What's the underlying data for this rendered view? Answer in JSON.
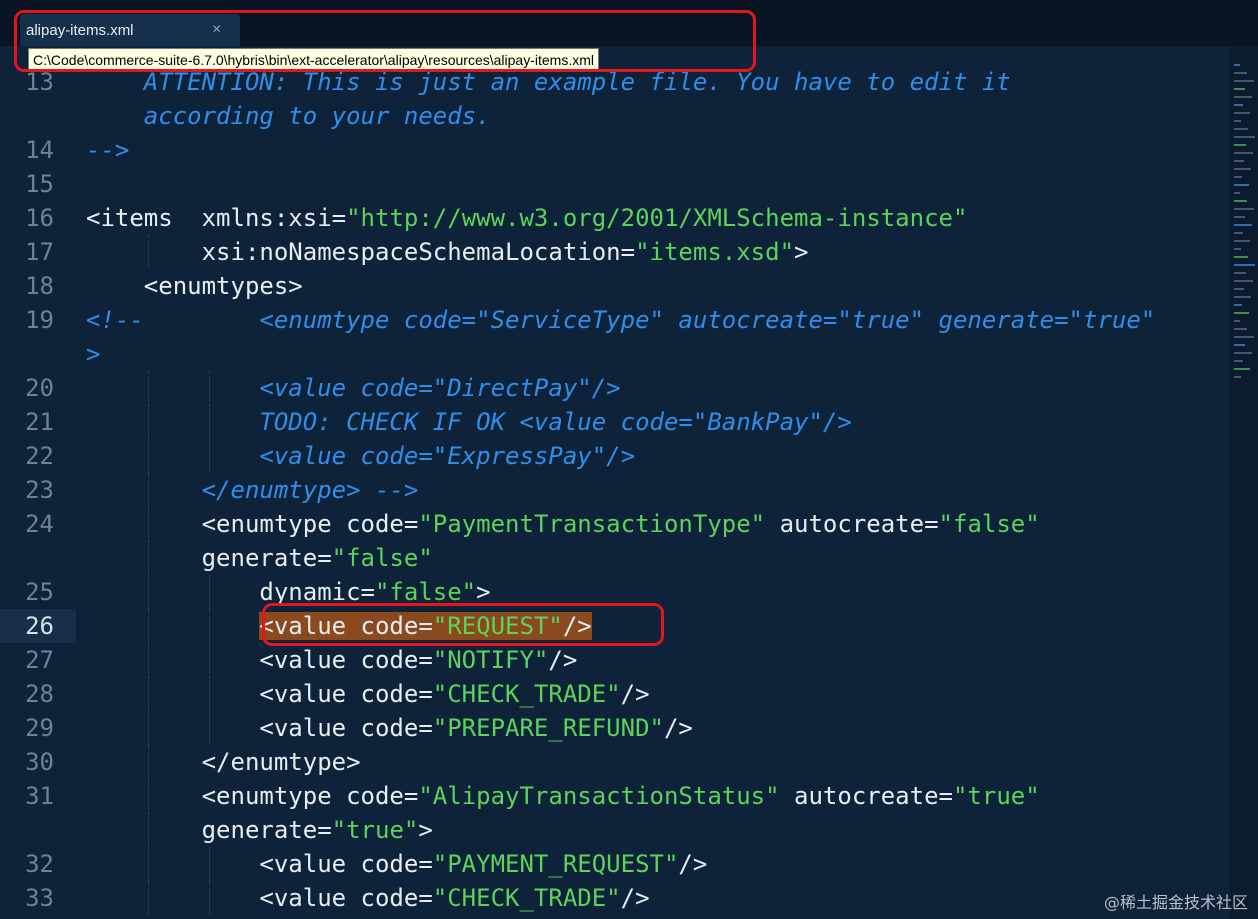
{
  "tab": {
    "title": "alipay-items.xml",
    "close_icon": "×"
  },
  "tooltip": {
    "path": "C:\\Code\\commerce-suite-6.7.0\\hybris\\bin\\ext-accelerator\\alipay\\resources\\alipay-items.xml"
  },
  "editor": {
    "current_line": "26",
    "lines": [
      {
        "n": "13",
        "text": "    ATTENTION: This is just an example file. You have to edit it"
      },
      {
        "n": "",
        "text": "    according to your needs."
      },
      {
        "n": "14",
        "text": "-->"
      },
      {
        "n": "15",
        "text": ""
      },
      {
        "n": "16",
        "text": "<items  xmlns:xsi=\"http://www.w3.org/2001/XMLSchema-instance\""
      },
      {
        "n": "17",
        "text": "        xsi:noNamespaceSchemaLocation=\"items.xsd\">"
      },
      {
        "n": "18",
        "text": "    <enumtypes>"
      },
      {
        "n": "19",
        "text": "<!--        <enumtype code=\"ServiceType\" autocreate=\"true\" generate=\"true\""
      },
      {
        "n": "",
        "text": ">"
      },
      {
        "n": "20",
        "text": "            <value code=\"DirectPay\"/>"
      },
      {
        "n": "21",
        "text": "            TODO: CHECK IF OK <value code=\"BankPay\"/>"
      },
      {
        "n": "22",
        "text": "            <value code=\"ExpressPay\"/>"
      },
      {
        "n": "23",
        "text": "        </enumtype> -->"
      },
      {
        "n": "24",
        "text": "        <enumtype code=\"PaymentTransactionType\" autocreate=\"false\""
      },
      {
        "n": "",
        "text": "        generate=\"false\""
      },
      {
        "n": "25",
        "text": "            dynamic=\"false\">"
      },
      {
        "n": "26",
        "text": "            <value code=\"REQUEST\"/>"
      },
      {
        "n": "27",
        "text": "            <value code=\"NOTIFY\"/>"
      },
      {
        "n": "28",
        "text": "            <value code=\"CHECK_TRADE\"/>"
      },
      {
        "n": "29",
        "text": "            <value code=\"PREPARE_REFUND\"/>"
      },
      {
        "n": "30",
        "text": "        </enumtype>"
      },
      {
        "n": "31",
        "text": "        <enumtype code=\"AlipayTransactionStatus\" autocreate=\"true\""
      },
      {
        "n": "",
        "text": "        generate=\"true\">"
      },
      {
        "n": "32",
        "text": "            <value code=\"PAYMENT_REQUEST\"/>"
      },
      {
        "n": "33",
        "text": "            <value code=\"CHECK_TRADE\"/>"
      }
    ]
  },
  "watermark": "@稀土掘金技术社区",
  "colors": {
    "background": "#0e223a",
    "comment": "#2f8fe8",
    "string": "#5cd35a",
    "tag": "#e6edf3",
    "highlight": "#8a4a1e",
    "annotation": "#e3161d"
  }
}
